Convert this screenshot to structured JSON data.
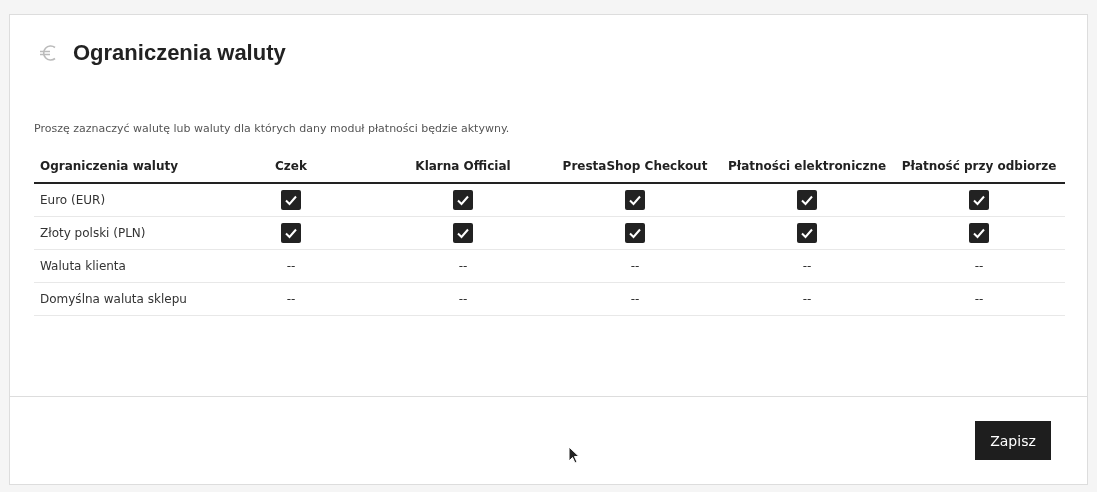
{
  "panel": {
    "title": "Ograniczenia waluty",
    "description": "Proszę zaznaczyć walutę lub waluty dla których dany moduł płatności będzie aktywny."
  },
  "table": {
    "columns": [
      "Ograniczenia waluty",
      "Czek",
      "Klarna Official",
      "PrestaShop Checkout",
      "Płatności elektroniczne",
      "Płatność przy odbiorze"
    ],
    "rows": [
      {
        "cells": [
          {
            "kind": "label",
            "text": "Euro (EUR)"
          },
          {
            "kind": "checkbox",
            "checked": true
          },
          {
            "kind": "checkbox",
            "checked": true
          },
          {
            "kind": "checkbox",
            "checked": true
          },
          {
            "kind": "checkbox",
            "checked": true
          },
          {
            "kind": "checkbox",
            "checked": true
          }
        ]
      },
      {
        "cells": [
          {
            "kind": "label",
            "text": "Złoty polski (PLN)"
          },
          {
            "kind": "checkbox",
            "checked": true
          },
          {
            "kind": "checkbox",
            "checked": true
          },
          {
            "kind": "checkbox",
            "checked": true
          },
          {
            "kind": "checkbox",
            "checked": true
          },
          {
            "kind": "checkbox",
            "checked": true
          }
        ]
      },
      {
        "cells": [
          {
            "kind": "label",
            "text": "Waluta klienta"
          },
          {
            "kind": "text",
            "text": "--"
          },
          {
            "kind": "text",
            "text": "--"
          },
          {
            "kind": "text",
            "text": "--"
          },
          {
            "kind": "text",
            "text": "--"
          },
          {
            "kind": "text",
            "text": "--"
          }
        ]
      },
      {
        "cells": [
          {
            "kind": "label",
            "text": "Domyślna waluta sklepu"
          },
          {
            "kind": "text",
            "text": "--"
          },
          {
            "kind": "text",
            "text": "--"
          },
          {
            "kind": "text",
            "text": "--"
          },
          {
            "kind": "text",
            "text": "--"
          },
          {
            "kind": "text",
            "text": "--"
          }
        ]
      }
    ]
  },
  "footer": {
    "save_button": "Zapisz"
  }
}
